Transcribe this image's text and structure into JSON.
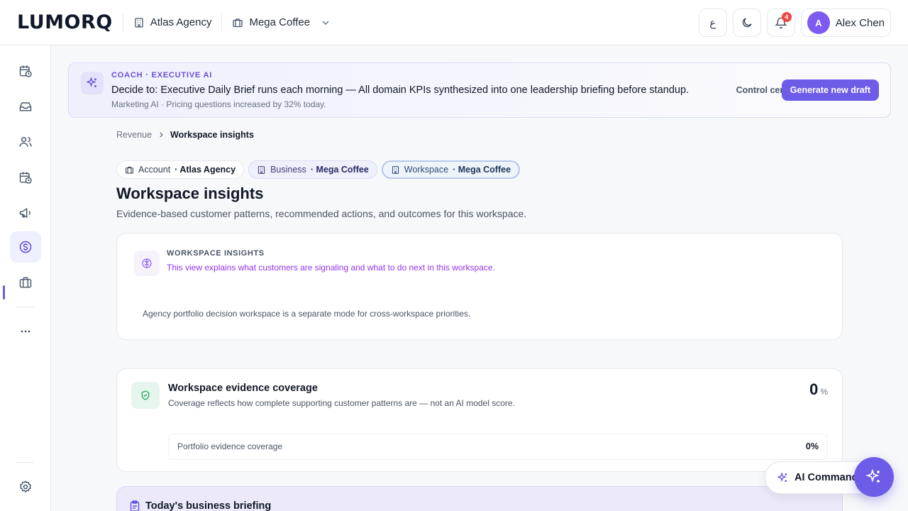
{
  "brand": {
    "logo": "LUMORQ"
  },
  "header": {
    "account": "Atlas Agency",
    "business": "Mega Coffee",
    "lang_button": "ع",
    "notifications_count": "4",
    "user": {
      "initial": "A",
      "name": "Alex Chen"
    }
  },
  "coach": {
    "eyebrow": "COACH · EXECUTIVE AI",
    "title": "Decide to: Executive Daily Brief runs each morning — All domain KPIs synthesized into one leadership briefing before standup.",
    "subtitle": "Marketing AI · Pricing questions increased by 32% today.",
    "control_label": "Control center",
    "generate_label": "Generate new draft"
  },
  "breadcrumb": {
    "parent": "Revenue",
    "current": "Workspace insights"
  },
  "chips": {
    "account": {
      "label": "Account",
      "value": "· Atlas Agency"
    },
    "business": {
      "label": "Business",
      "value": "· Mega Coffee"
    },
    "workspace": {
      "label": "Workspace",
      "value": "· Mega Coffee"
    }
  },
  "page": {
    "title": "Workspace insights",
    "subtitle": "Evidence-based customer patterns, recommended actions, and outcomes for this workspace."
  },
  "insights_card": {
    "eyebrow": "WORKSPACE INSIGHTS",
    "description": "This view explains what customers are signaling and what to do next in this workspace.",
    "note": "Agency portfolio decision workspace is a separate mode for cross-workspace priorities."
  },
  "coverage_card": {
    "title": "Workspace evidence coverage",
    "subtitle": "Coverage reflects how complete supporting customer patterns are — not an AI model score.",
    "value": "0",
    "unit": "%",
    "row_label": "Portfolio evidence coverage",
    "row_value": "0%"
  },
  "briefing_card": {
    "title": "Today's business briefing"
  },
  "ai_command": {
    "label": "AI Command"
  },
  "colors": {
    "accent": "#6d5ce8",
    "success": "#16a34a",
    "alert": "#ef4444"
  }
}
